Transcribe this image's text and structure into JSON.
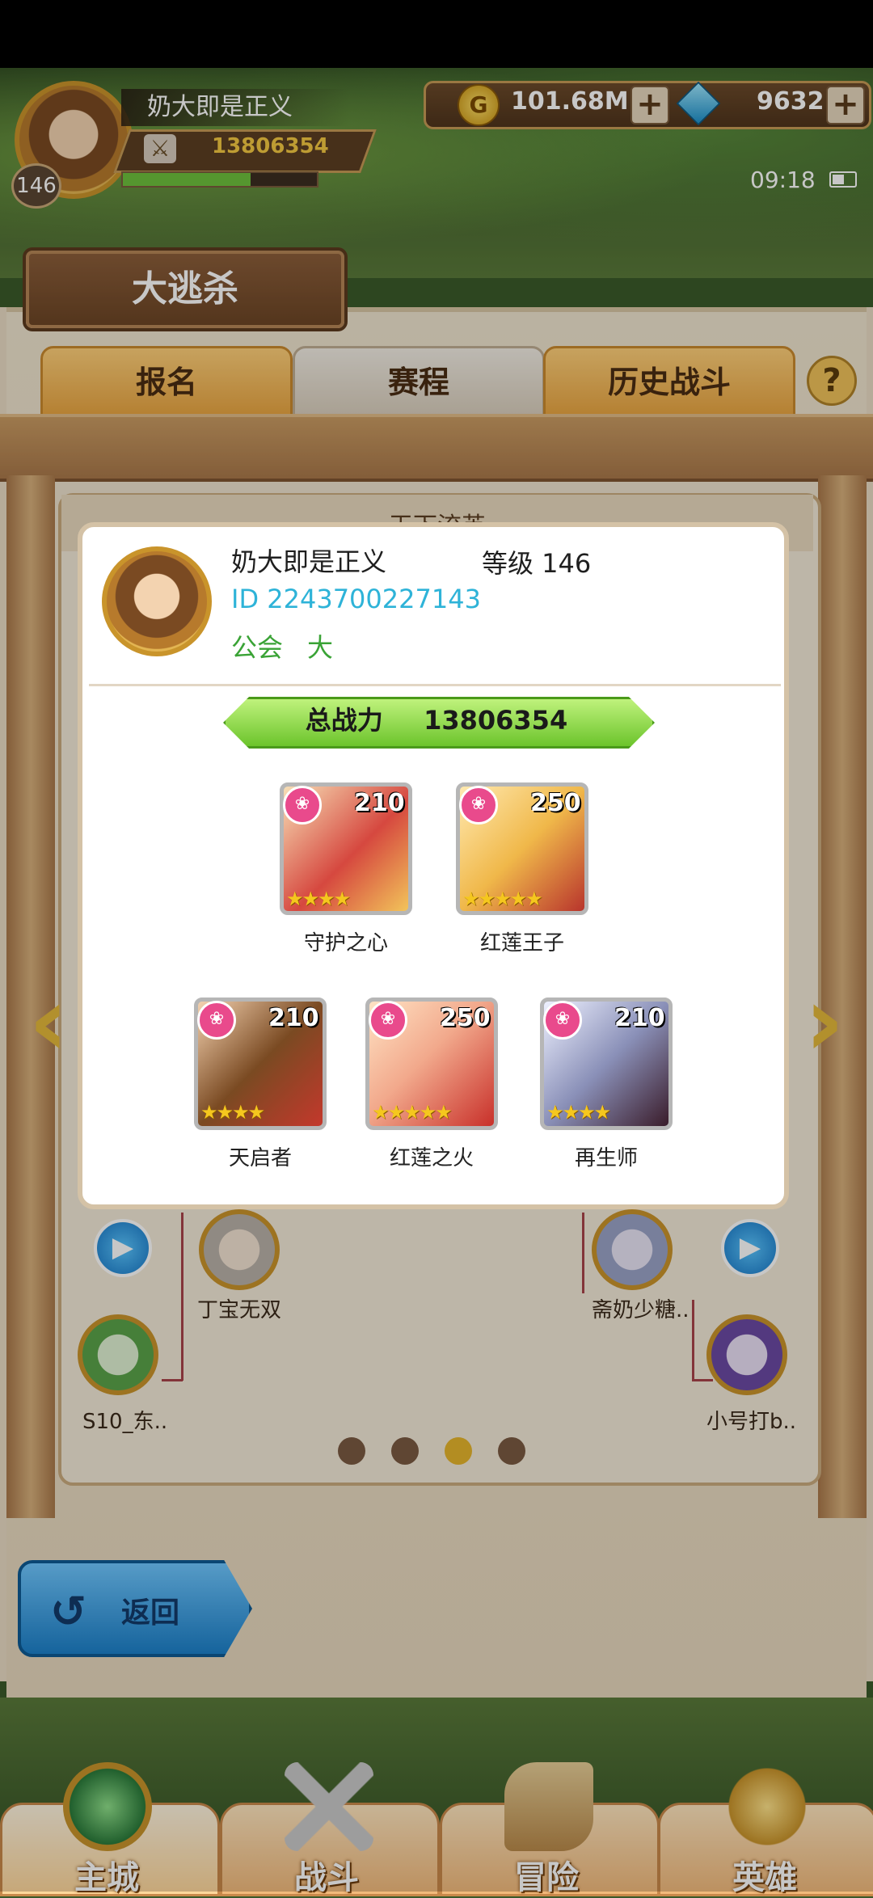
{
  "header": {
    "player_name": "奶大即是正义",
    "player_level": "146",
    "combat_power": "13806354",
    "xp_fraction": 0.66,
    "gold": "101.68M",
    "gems": "9632",
    "clock": "09:18",
    "plus_symbol": "+"
  },
  "mode_title": "大逃杀",
  "tabs": [
    {
      "label": "报名"
    },
    {
      "label": "赛程"
    },
    {
      "label": "历史战斗"
    }
  ],
  "help_label": "?",
  "board": {
    "title_partial": "天下流英",
    "page_dots": 4,
    "active_dot": 2,
    "players": [
      {
        "name": "丁宝无双"
      },
      {
        "name": "斋奶少糖.."
      },
      {
        "name": "S10_东.."
      },
      {
        "name": "小号打b.."
      }
    ]
  },
  "popup": {
    "name": "奶大即是正义",
    "level_label": "等级 146",
    "id_label": "ID 2243700227143",
    "guild_label": "公会",
    "guild_value": "大",
    "power_label": "总战力",
    "power_value": "13806354",
    "heroes_row1": [
      {
        "name": "守护之心",
        "level": "210",
        "stars": "★★★★"
      },
      {
        "name": "红莲王子",
        "level": "250",
        "stars": "★★★★★"
      }
    ],
    "heroes_row2": [
      {
        "name": "天启者",
        "level": "210",
        "stars": "★★★★"
      },
      {
        "name": "红莲之火",
        "level": "250",
        "stars": "★★★★★"
      },
      {
        "name": "再生师",
        "level": "210",
        "stars": "★★★★"
      }
    ]
  },
  "back_label": "返回",
  "back_icon": "↺",
  "bottom_nav": [
    {
      "label": "主城",
      "icon": "castle-icon"
    },
    {
      "label": "战斗",
      "icon": "crossed-swords-icon"
    },
    {
      "label": "冒险",
      "icon": "scroll-map-icon"
    },
    {
      "label": "英雄",
      "icon": "hero-crest-icon"
    }
  ],
  "colors": {
    "accent_orange": "#e8a440",
    "id_blue": "#2eb3d8",
    "guild_green": "#3aa336",
    "power_gold": "#f4c842"
  }
}
